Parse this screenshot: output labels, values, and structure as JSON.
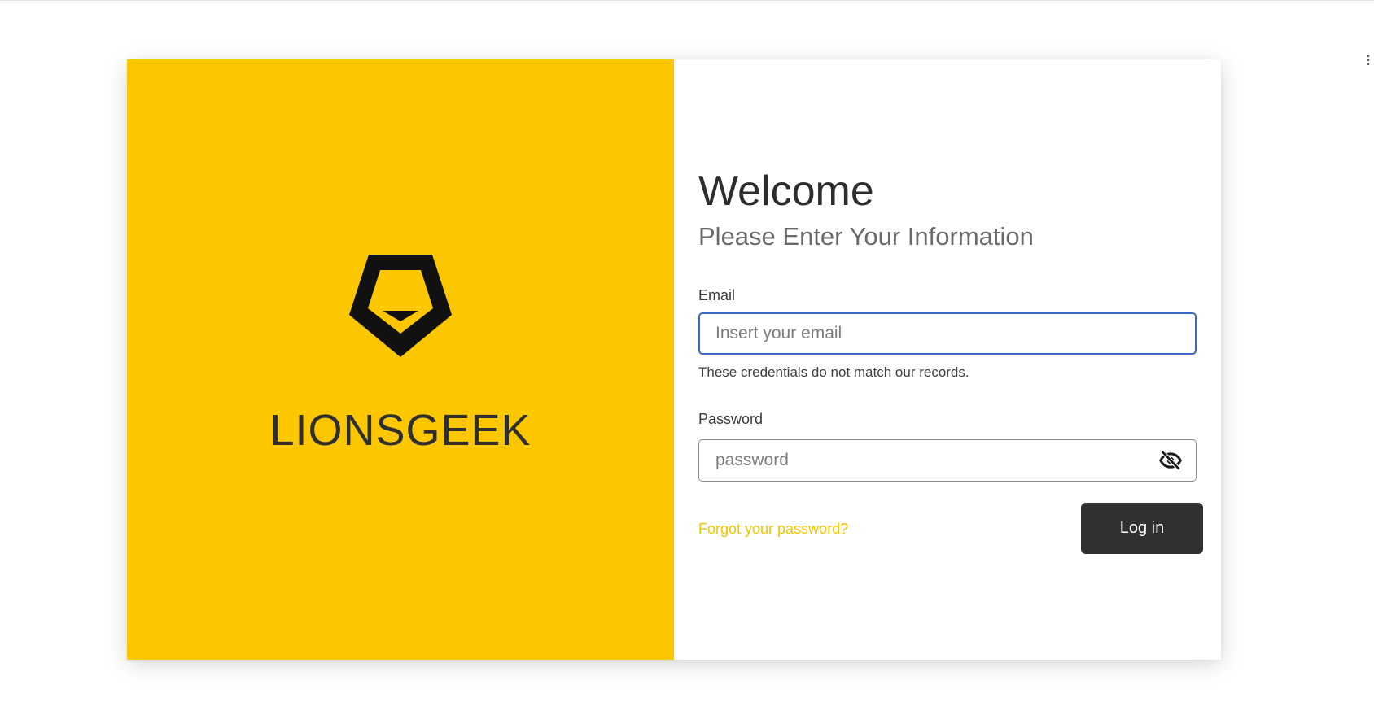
{
  "colors": {
    "brand_yellow": "#fdc700",
    "login_button": "#303030",
    "link": "#f2c500",
    "focus_border": "#3b66c4"
  },
  "brand": {
    "name": "LIONSGEEK",
    "logo_icon": "lion-head-logo-icon"
  },
  "form": {
    "title": "Welcome",
    "subtitle": "Please Enter Your Information",
    "email": {
      "label": "Email",
      "placeholder": "Insert your email",
      "value": "",
      "error": "These credentials do not match our records."
    },
    "password": {
      "label": "Password",
      "placeholder": "password",
      "value": "",
      "toggle_icon": "eye-off-icon"
    },
    "forgot_label": "Forgot your password?",
    "login_label": "Log in"
  }
}
